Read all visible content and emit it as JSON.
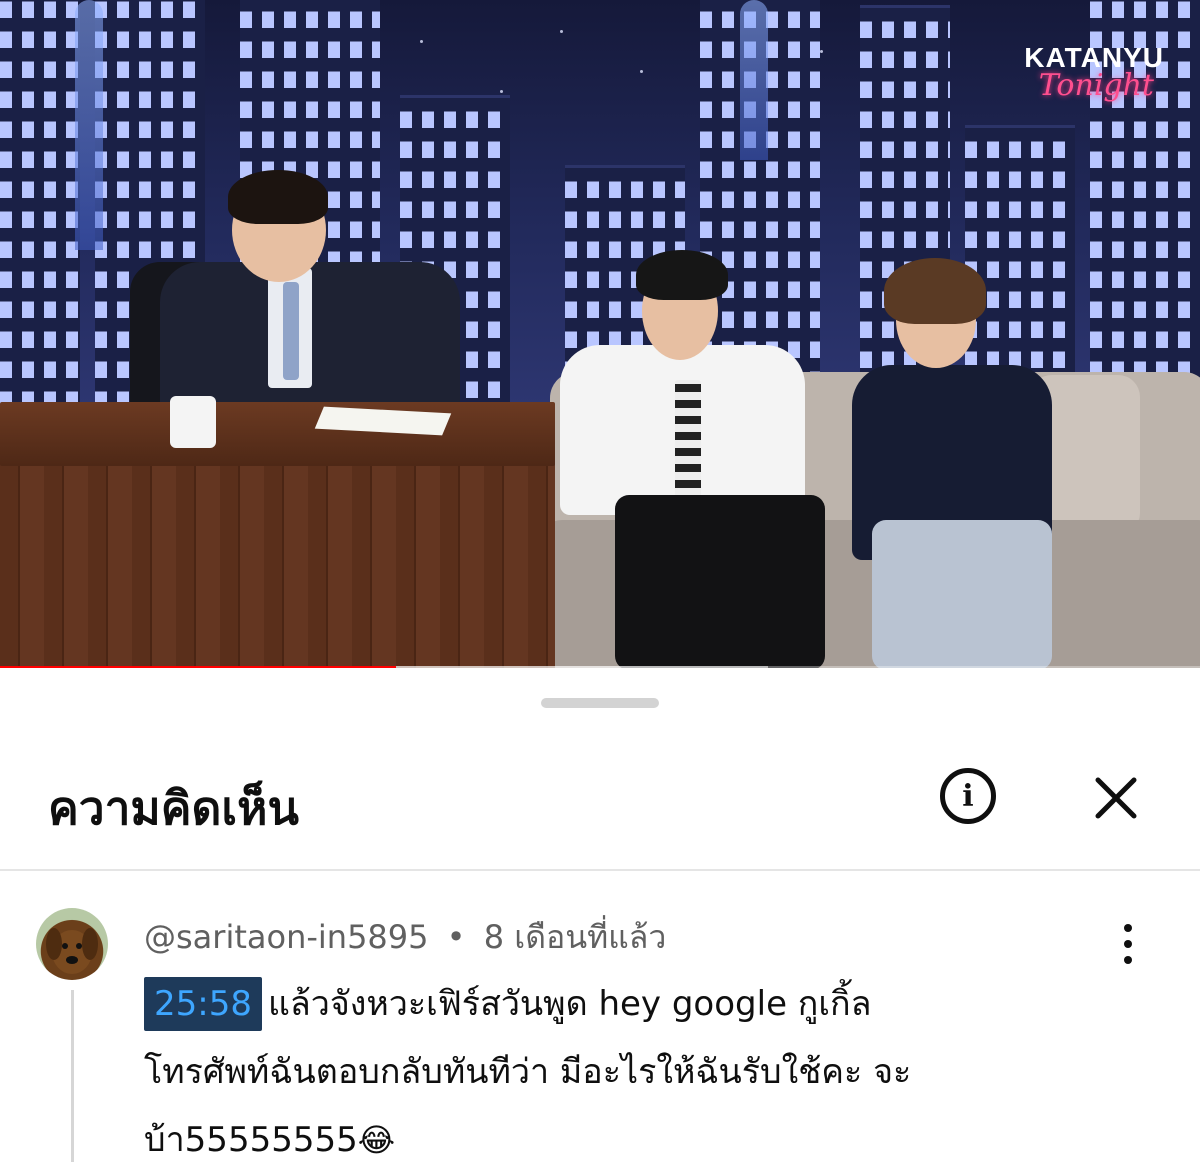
{
  "video": {
    "brand_main": "KATANYU",
    "brand_script": "Tonight",
    "progress_fraction": 0.33,
    "buffer_fraction": 0.64
  },
  "comments_panel": {
    "title": "ความคิดเห็น",
    "info_icon": "info-icon",
    "close_icon": "close-icon"
  },
  "comment": {
    "author": "@saritaon-in5895",
    "separator": "•",
    "time_ago": "8 เดือนที่แล้ว",
    "timestamp_link": "25:58",
    "text_line1": "แล้วจังหวะเฟิร์สวันพูด hey google กูเกิ้ล",
    "text_line2": "โทรศัพท์ฉันตอบกลับทันทีว่า มีอะไรให้ฉันรับใช้คะ จะ",
    "text_line3": "บ้า55555555",
    "emoji": "😂"
  },
  "colors": {
    "accent_red": "#ff0000",
    "timestamp_bg": "#1e3a5a",
    "timestamp_text": "#3ea6ff"
  }
}
